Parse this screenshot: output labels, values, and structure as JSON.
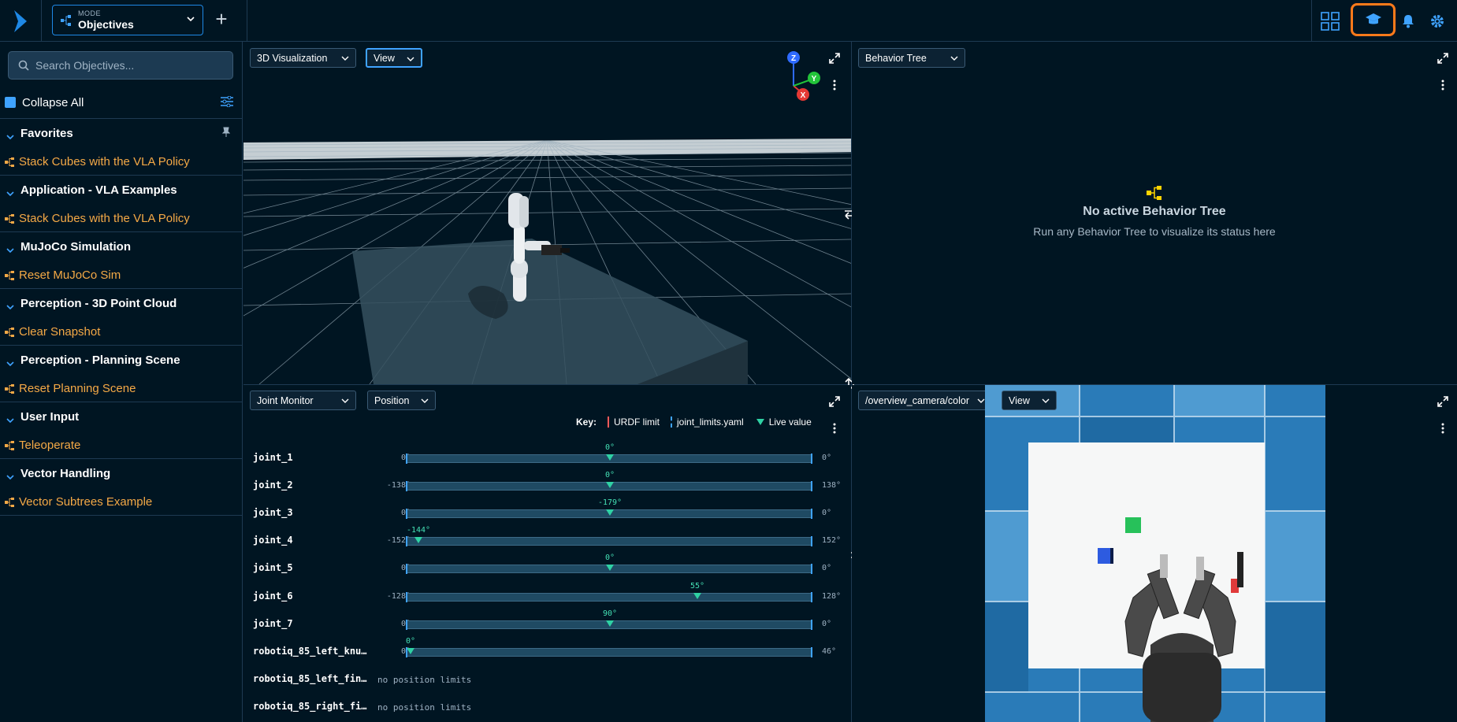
{
  "mode": {
    "label": "MODE",
    "value": "Objectives"
  },
  "sidebar": {
    "search_placeholder": "Search Objectives...",
    "collapse_all": "Collapse All",
    "categories": [
      {
        "name": "Favorites",
        "item": "Stack Cubes with the VLA Policy"
      },
      {
        "name": "Application - VLA Examples",
        "item": "Stack Cubes with the VLA Policy"
      },
      {
        "name": "MuJoCo Simulation",
        "item": "Reset MuJoCo Sim"
      },
      {
        "name": "Perception - 3D Point Cloud",
        "item": "Clear Snapshot"
      },
      {
        "name": "Perception - Planning Scene",
        "item": "Reset Planning Scene"
      },
      {
        "name": "User Input",
        "item": "Teleoperate"
      },
      {
        "name": "Vector Handling",
        "item": "Vector Subtrees Example"
      }
    ]
  },
  "viz": {
    "panel": "3D Visualization",
    "view": "View",
    "axes": {
      "z": "Z",
      "x": "X",
      "y": "Y"
    }
  },
  "bt": {
    "panel": "Behavior Tree",
    "title": "No active Behavior Tree",
    "subtitle": "Run any Behavior Tree to visualize its status here"
  },
  "jm": {
    "panel": "Joint Monitor",
    "mode": "Position",
    "key": {
      "label": "Key:",
      "urdf": "URDF limit",
      "yaml": "joint_limits.yaml",
      "live": "Live value"
    },
    "joints": [
      {
        "name": "joint_1",
        "min": "0°",
        "max": "0°",
        "cur": "0°",
        "pos": 0.5
      },
      {
        "name": "joint_2",
        "min": "-138°",
        "max": "138°",
        "cur": "0°",
        "pos": 0.5
      },
      {
        "name": "joint_3",
        "min": "0°",
        "max": "0°",
        "cur": "-179°",
        "pos": 0.5
      },
      {
        "name": "joint_4",
        "min": "-152°",
        "max": "152°",
        "cur": "-144°",
        "pos": 0.03
      },
      {
        "name": "joint_5",
        "min": "0°",
        "max": "0°",
        "cur": "0°",
        "pos": 0.5
      },
      {
        "name": "joint_6",
        "min": "-128°",
        "max": "128°",
        "cur": "55°",
        "pos": 0.715
      },
      {
        "name": "joint_7",
        "min": "0°",
        "max": "0°",
        "cur": "90°",
        "pos": 0.5
      },
      {
        "name": "robotiq_85_left_knu…",
        "min": "0°",
        "max": "46°",
        "cur": "0°",
        "pos": 0.01
      }
    ],
    "nolimit_joints": [
      {
        "name": "robotiq_85_left_fin…",
        "text": "no position limits"
      },
      {
        "name": "robotiq_85_right_fi…",
        "text": "no position limits"
      }
    ]
  },
  "cam": {
    "topic": "/overview_camera/color",
    "view": "View"
  },
  "colors": {
    "accent": "#3fa3ff",
    "objective": "#f5a946",
    "live": "#2fd1a4",
    "highlight": "#ff7a1a"
  }
}
